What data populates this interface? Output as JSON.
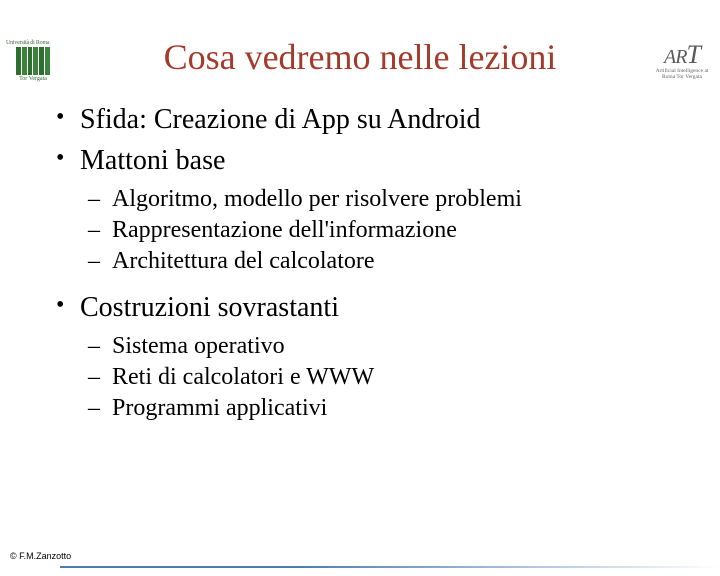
{
  "header": {
    "uni_top": "Università di Roma",
    "uni_bottom": "Tor Vergata",
    "art_sub": "Artificial Intelligence\nat Roma Tor Vergata"
  },
  "title": "Cosa vedremo nelle lezioni",
  "bullets": [
    {
      "text": "Sfida: Creazione di App su Android"
    },
    {
      "text": "Mattoni base",
      "sub": [
        "Algoritmo, modello per risolvere problemi",
        "Rappresentazione dell'informazione",
        "Architettura del calcolatore"
      ]
    },
    {
      "text": "Costruzioni sovrastanti",
      "sub": [
        "Sistema operativo",
        "Reti di calcolatori e WWW",
        "Programmi applicativi"
      ]
    }
  ],
  "footer": {
    "copyright": "© F.M.Zanzotto"
  }
}
